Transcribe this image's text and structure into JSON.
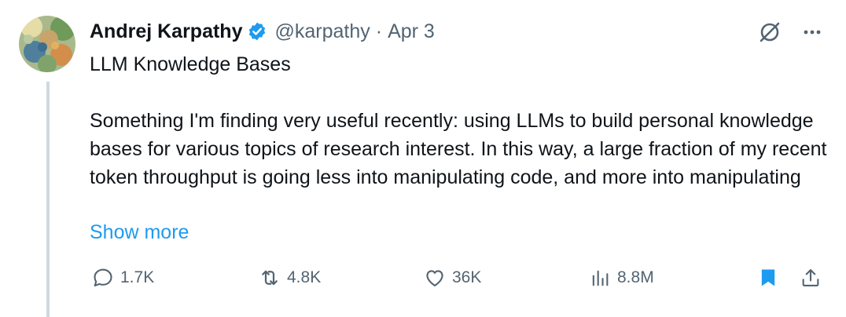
{
  "tweet": {
    "author_name": "Andrej Karpathy",
    "handle": "@karpathy",
    "separator": "·",
    "date": "Apr 3",
    "title": "LLM Knowledge Bases",
    "body": "Something I'm finding very useful recently: using LLMs to build personal knowledge bases for various topics of research interest. In this way, a large fraction of my recent token throughput is going less into manipulating code, and more into manipulating",
    "show_more": "Show more"
  },
  "stats": {
    "replies": "1.7K",
    "retweets": "4.8K",
    "likes": "36K",
    "views": "8.8M"
  },
  "icons": {
    "verified": "verified-badge-icon",
    "grok": "grok-icon",
    "more": "more-icon",
    "reply": "reply-icon",
    "retweet": "retweet-icon",
    "like": "heart-icon",
    "views": "views-icon",
    "bookmark": "bookmark-icon",
    "share": "share-icon"
  },
  "colors": {
    "text": "#0f1419",
    "secondary": "#536471",
    "link": "#1d9bf0",
    "thread_line": "#cfd9de"
  }
}
